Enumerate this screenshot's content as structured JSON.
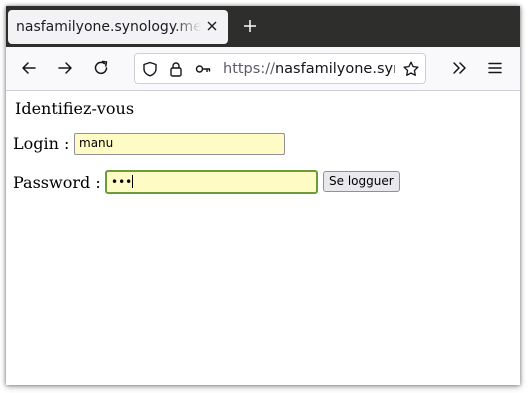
{
  "browser": {
    "tab": {
      "title": "nasfamilyone.synology.me/TestLogin"
    },
    "toolbar": {
      "url_scheme": "https://",
      "url_host": "nasfamilyone.synology.me/TestLogin",
      "icons": [
        "back-icon",
        "forward-icon",
        "reload-icon",
        "shield-icon",
        "lock-icon",
        "key-icon",
        "bookmark-star-icon",
        "overflow-chevron-icon",
        "menu-icon"
      ]
    }
  },
  "page": {
    "heading": "Identifiez-vous",
    "login_label": "Login :",
    "login_value": "manu",
    "password_label": "Password :",
    "password_masked": "•••",
    "submit_label": "Se logguer"
  },
  "colors": {
    "tabbar_bg": "#2e2e2c",
    "autofill_bg": "#fefcc4",
    "focus_border": "#6b9b3a"
  }
}
